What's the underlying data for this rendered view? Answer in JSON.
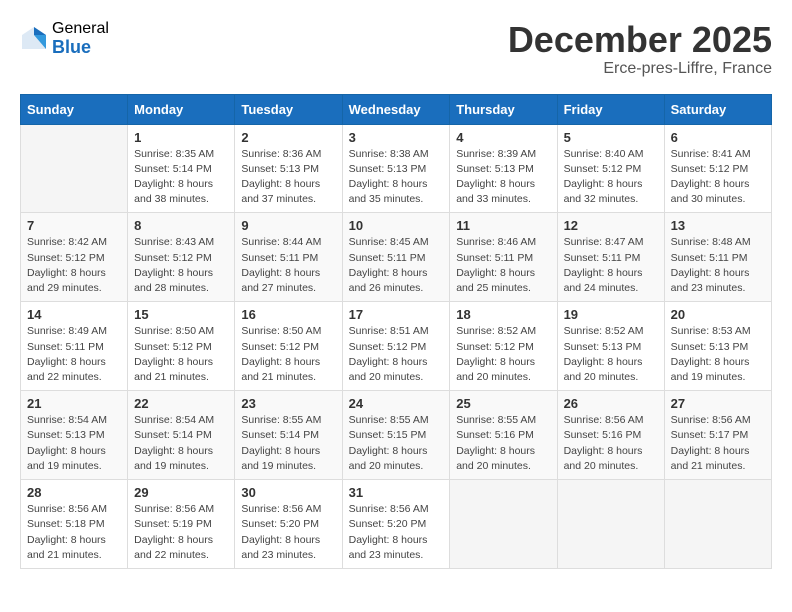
{
  "logo": {
    "general": "General",
    "blue": "Blue"
  },
  "title": "December 2025",
  "subtitle": "Erce-pres-Liffre, France",
  "weekdays": [
    "Sunday",
    "Monday",
    "Tuesday",
    "Wednesday",
    "Thursday",
    "Friday",
    "Saturday"
  ],
  "weeks": [
    [
      {
        "day": "",
        "info": ""
      },
      {
        "day": "1",
        "info": "Sunrise: 8:35 AM\nSunset: 5:14 PM\nDaylight: 8 hours\nand 38 minutes."
      },
      {
        "day": "2",
        "info": "Sunrise: 8:36 AM\nSunset: 5:13 PM\nDaylight: 8 hours\nand 37 minutes."
      },
      {
        "day": "3",
        "info": "Sunrise: 8:38 AM\nSunset: 5:13 PM\nDaylight: 8 hours\nand 35 minutes."
      },
      {
        "day": "4",
        "info": "Sunrise: 8:39 AM\nSunset: 5:13 PM\nDaylight: 8 hours\nand 33 minutes."
      },
      {
        "day": "5",
        "info": "Sunrise: 8:40 AM\nSunset: 5:12 PM\nDaylight: 8 hours\nand 32 minutes."
      },
      {
        "day": "6",
        "info": "Sunrise: 8:41 AM\nSunset: 5:12 PM\nDaylight: 8 hours\nand 30 minutes."
      }
    ],
    [
      {
        "day": "7",
        "info": "Sunrise: 8:42 AM\nSunset: 5:12 PM\nDaylight: 8 hours\nand 29 minutes."
      },
      {
        "day": "8",
        "info": "Sunrise: 8:43 AM\nSunset: 5:12 PM\nDaylight: 8 hours\nand 28 minutes."
      },
      {
        "day": "9",
        "info": "Sunrise: 8:44 AM\nSunset: 5:11 PM\nDaylight: 8 hours\nand 27 minutes."
      },
      {
        "day": "10",
        "info": "Sunrise: 8:45 AM\nSunset: 5:11 PM\nDaylight: 8 hours\nand 26 minutes."
      },
      {
        "day": "11",
        "info": "Sunrise: 8:46 AM\nSunset: 5:11 PM\nDaylight: 8 hours\nand 25 minutes."
      },
      {
        "day": "12",
        "info": "Sunrise: 8:47 AM\nSunset: 5:11 PM\nDaylight: 8 hours\nand 24 minutes."
      },
      {
        "day": "13",
        "info": "Sunrise: 8:48 AM\nSunset: 5:11 PM\nDaylight: 8 hours\nand 23 minutes."
      }
    ],
    [
      {
        "day": "14",
        "info": "Sunrise: 8:49 AM\nSunset: 5:11 PM\nDaylight: 8 hours\nand 22 minutes."
      },
      {
        "day": "15",
        "info": "Sunrise: 8:50 AM\nSunset: 5:12 PM\nDaylight: 8 hours\nand 21 minutes."
      },
      {
        "day": "16",
        "info": "Sunrise: 8:50 AM\nSunset: 5:12 PM\nDaylight: 8 hours\nand 21 minutes."
      },
      {
        "day": "17",
        "info": "Sunrise: 8:51 AM\nSunset: 5:12 PM\nDaylight: 8 hours\nand 20 minutes."
      },
      {
        "day": "18",
        "info": "Sunrise: 8:52 AM\nSunset: 5:12 PM\nDaylight: 8 hours\nand 20 minutes."
      },
      {
        "day": "19",
        "info": "Sunrise: 8:52 AM\nSunset: 5:13 PM\nDaylight: 8 hours\nand 20 minutes."
      },
      {
        "day": "20",
        "info": "Sunrise: 8:53 AM\nSunset: 5:13 PM\nDaylight: 8 hours\nand 19 minutes."
      }
    ],
    [
      {
        "day": "21",
        "info": "Sunrise: 8:54 AM\nSunset: 5:13 PM\nDaylight: 8 hours\nand 19 minutes."
      },
      {
        "day": "22",
        "info": "Sunrise: 8:54 AM\nSunset: 5:14 PM\nDaylight: 8 hours\nand 19 minutes."
      },
      {
        "day": "23",
        "info": "Sunrise: 8:55 AM\nSunset: 5:14 PM\nDaylight: 8 hours\nand 19 minutes."
      },
      {
        "day": "24",
        "info": "Sunrise: 8:55 AM\nSunset: 5:15 PM\nDaylight: 8 hours\nand 20 minutes."
      },
      {
        "day": "25",
        "info": "Sunrise: 8:55 AM\nSunset: 5:16 PM\nDaylight: 8 hours\nand 20 minutes."
      },
      {
        "day": "26",
        "info": "Sunrise: 8:56 AM\nSunset: 5:16 PM\nDaylight: 8 hours\nand 20 minutes."
      },
      {
        "day": "27",
        "info": "Sunrise: 8:56 AM\nSunset: 5:17 PM\nDaylight: 8 hours\nand 21 minutes."
      }
    ],
    [
      {
        "day": "28",
        "info": "Sunrise: 8:56 AM\nSunset: 5:18 PM\nDaylight: 8 hours\nand 21 minutes."
      },
      {
        "day": "29",
        "info": "Sunrise: 8:56 AM\nSunset: 5:19 PM\nDaylight: 8 hours\nand 22 minutes."
      },
      {
        "day": "30",
        "info": "Sunrise: 8:56 AM\nSunset: 5:20 PM\nDaylight: 8 hours\nand 23 minutes."
      },
      {
        "day": "31",
        "info": "Sunrise: 8:56 AM\nSunset: 5:20 PM\nDaylight: 8 hours\nand 23 minutes."
      },
      {
        "day": "",
        "info": ""
      },
      {
        "day": "",
        "info": ""
      },
      {
        "day": "",
        "info": ""
      }
    ]
  ]
}
